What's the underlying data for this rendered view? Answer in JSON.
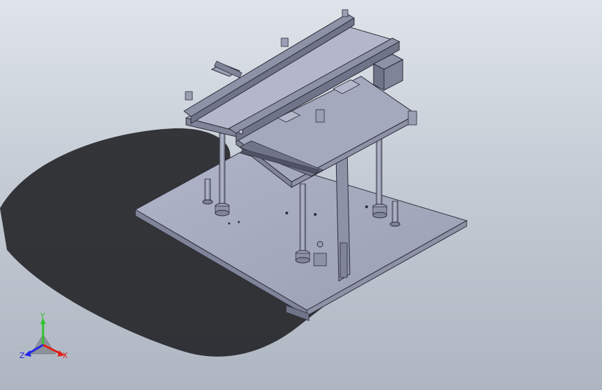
{
  "viewport": {
    "background_top": "#dfe4ea",
    "background_bottom": "#aeb6c2"
  },
  "model": {
    "part_fill": "#a4a9bd",
    "part_dark": "#6f7489",
    "part_edge": "#2b2d38",
    "shadow": "#1e1f22"
  },
  "triad": {
    "x_label": "X",
    "y_label": "Y",
    "z_label": "Z",
    "x_color": "#e0201b",
    "y_color": "#2fc42f",
    "z_color": "#2424e6"
  }
}
